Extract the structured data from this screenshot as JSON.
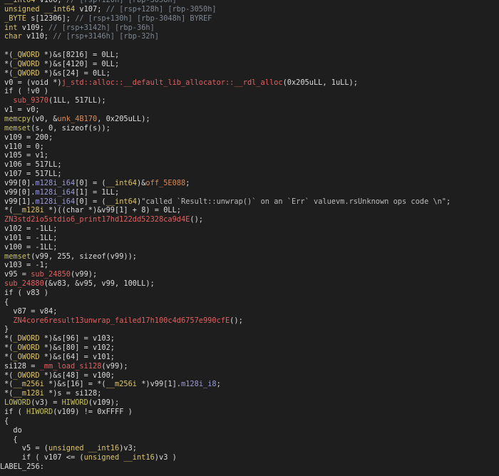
{
  "colors": {
    "background": "#1e1e1e",
    "text": "#dcdcdc",
    "type": "#dcc36b",
    "comment": "#7f8792",
    "function": "#c5c15c",
    "identifier": "#9a9ad8",
    "data_ref": "#d98a56",
    "red_func": "#e06060",
    "string": "#bcbcbc",
    "number": "#e6e6e6"
  },
  "lines": [
    [
      [
        "type",
        "__int64"
      ],
      [
        "text",
        " v106; "
      ],
      [
        "comment",
        "// [rsp+120h] [rbp-3058h]"
      ]
    ],
    [
      [
        "type",
        "unsigned __int64"
      ],
      [
        "text",
        " v107; "
      ],
      [
        "comment",
        "// [rsp+128h] [rbp-3050h]"
      ]
    ],
    [
      [
        "type",
        "_BYTE"
      ],
      [
        "text",
        " s[12306]; "
      ],
      [
        "comment",
        "// [rsp+130h] [rbp-3048h] BYREF"
      ]
    ],
    [
      [
        "type",
        "int"
      ],
      [
        "text",
        " v109; "
      ],
      [
        "comment",
        "// [rsp+3142h] [rbp-36h]"
      ]
    ],
    [
      [
        "type",
        "char"
      ],
      [
        "text",
        " v110; "
      ],
      [
        "comment",
        "// [rsp+3146h] [rbp-32h]"
      ]
    ],
    [
      [
        "text",
        ""
      ]
    ],
    [
      [
        "text",
        "*("
      ],
      [
        "type",
        "_QWORD"
      ],
      [
        "text",
        " *)&s[8216] = 0LL;"
      ]
    ],
    [
      [
        "text",
        "*("
      ],
      [
        "type",
        "_QWORD"
      ],
      [
        "text",
        " *)&s[4120] = 0LL;"
      ]
    ],
    [
      [
        "text",
        "*("
      ],
      [
        "type",
        "_QWORD"
      ],
      [
        "text",
        " *)&s[24] = 0LL;"
      ]
    ],
    [
      [
        "text",
        "v0 = (void *)"
      ],
      [
        "red_func",
        "j_std::alloc::__default_lib_allocator::__rdl_alloc"
      ],
      [
        "text",
        "(0x205uLL, 1uLL);"
      ]
    ],
    [
      [
        "text",
        "if ( !v0 )"
      ]
    ],
    [
      [
        "text",
        "  "
      ],
      [
        "red_func",
        "sub_9370"
      ],
      [
        "text",
        "(1LL, 517LL);"
      ]
    ],
    [
      [
        "text",
        "v1 = v0;"
      ]
    ],
    [
      [
        "function",
        "memcpy"
      ],
      [
        "text",
        "(v0, &"
      ],
      [
        "data_ref",
        "unk_4B170"
      ],
      [
        "text",
        ", 0x205uLL);"
      ]
    ],
    [
      [
        "function",
        "memset"
      ],
      [
        "text",
        "(s, 0, sizeof(s));"
      ]
    ],
    [
      [
        "text",
        "v109 = 200;"
      ]
    ],
    [
      [
        "text",
        "v110 = 0;"
      ]
    ],
    [
      [
        "text",
        "v105 = v1;"
      ]
    ],
    [
      [
        "text",
        "v106 = 517LL;"
      ]
    ],
    [
      [
        "text",
        "v107 = 517LL;"
      ]
    ],
    [
      [
        "text",
        "v99[0]."
      ],
      [
        "identifier",
        "m128i_i64"
      ],
      [
        "text",
        "[0] = ("
      ],
      [
        "type",
        "__int64"
      ],
      [
        "text",
        ")&"
      ],
      [
        "data_ref",
        "off_5E088"
      ],
      [
        "text",
        ";"
      ]
    ],
    [
      [
        "text",
        "v99[0]."
      ],
      [
        "identifier",
        "m128i_i64"
      ],
      [
        "text",
        "[1] = 1LL;"
      ]
    ],
    [
      [
        "text",
        "v99[1]."
      ],
      [
        "identifier",
        "m128i_i64"
      ],
      [
        "text",
        "[0] = ("
      ],
      [
        "type",
        "__int64"
      ],
      [
        "text",
        ")"
      ],
      [
        "string",
        "\"called `Result::unwrap()` on an `Err` valuevm.rsUnknown ops code \\n\""
      ],
      [
        "text",
        ";"
      ]
    ],
    [
      [
        "text",
        "*("
      ],
      [
        "type",
        "__m128i"
      ],
      [
        "text",
        " *)((char *)&v99[1] + 8) = 0LL;"
      ]
    ],
    [
      [
        "red_func",
        "ZN3std2io5stdio6_print17hd122dd52328ca9d4E"
      ],
      [
        "text",
        "();"
      ]
    ],
    [
      [
        "text",
        "v102 = -1LL;"
      ]
    ],
    [
      [
        "text",
        "v101 = -1LL;"
      ]
    ],
    [
      [
        "text",
        "v100 = -1LL;"
      ]
    ],
    [
      [
        "function",
        "memset"
      ],
      [
        "text",
        "(v99, 255, sizeof(v99));"
      ]
    ],
    [
      [
        "text",
        "v103 = -1;"
      ]
    ],
    [
      [
        "text",
        "v95 = "
      ],
      [
        "red_func",
        "sub_24850"
      ],
      [
        "text",
        "(v99);"
      ]
    ],
    [
      [
        "red_func",
        "sub_24880"
      ],
      [
        "text",
        "(&v83, &v95, v99, 100LL);"
      ]
    ],
    [
      [
        "text",
        "if ( v83 )"
      ]
    ],
    [
      [
        "text",
        "{"
      ]
    ],
    [
      [
        "text",
        "  v87 = v84;"
      ]
    ],
    [
      [
        "text",
        "  "
      ],
      [
        "red_func",
        "ZN4core6result13unwrap_failed17h100c4d6757e990cfE"
      ],
      [
        "text",
        "();"
      ]
    ],
    [
      [
        "text",
        "}"
      ]
    ],
    [
      [
        "text",
        "*("
      ],
      [
        "type",
        "_DWORD"
      ],
      [
        "text",
        " *)&s[96] = v103;"
      ]
    ],
    [
      [
        "text",
        "*("
      ],
      [
        "type",
        "_OWORD"
      ],
      [
        "text",
        " *)&s[80] = v102;"
      ]
    ],
    [
      [
        "text",
        "*("
      ],
      [
        "type",
        "_OWORD"
      ],
      [
        "text",
        " *)&s[64] = v101;"
      ]
    ],
    [
      [
        "text",
        "si128 = "
      ],
      [
        "red_func",
        "_mm_load_si128"
      ],
      [
        "text",
        "(v99);"
      ]
    ],
    [
      [
        "text",
        "*("
      ],
      [
        "type",
        "_OWORD"
      ],
      [
        "text",
        " *)&s[48] = v100;"
      ]
    ],
    [
      [
        "text",
        "*("
      ],
      [
        "type",
        "__m256i"
      ],
      [
        "text",
        " *)&s[16] = *("
      ],
      [
        "type",
        "__m256i"
      ],
      [
        "text",
        " *)v99[1]."
      ],
      [
        "identifier",
        "m128i_i8"
      ],
      [
        "text",
        ";"
      ]
    ],
    [
      [
        "text",
        "*("
      ],
      [
        "type",
        "__m128i"
      ],
      [
        "text",
        " *)s = si128;"
      ]
    ],
    [
      [
        "function",
        "LOWORD"
      ],
      [
        "text",
        "(v3) = "
      ],
      [
        "function",
        "HIWORD"
      ],
      [
        "text",
        "(v109);"
      ]
    ],
    [
      [
        "text",
        "if ( "
      ],
      [
        "function",
        "HIWORD"
      ],
      [
        "text",
        "(v109) != 0xFFFF )"
      ]
    ],
    [
      [
        "text",
        "{"
      ]
    ],
    [
      [
        "text",
        "  do"
      ]
    ],
    [
      [
        "text",
        "  {"
      ]
    ],
    [
      [
        "text",
        "    v5 = ("
      ],
      [
        "type",
        "unsigned __int16"
      ],
      [
        "text",
        ")v3;"
      ]
    ],
    [
      [
        "text",
        "    if ( v107 <= ("
      ],
      [
        "type",
        "unsigned __int16"
      ],
      [
        "text",
        ")v3 )"
      ]
    ],
    [
      [
        "text",
        "LABEL_256:"
      ]
    ]
  ]
}
